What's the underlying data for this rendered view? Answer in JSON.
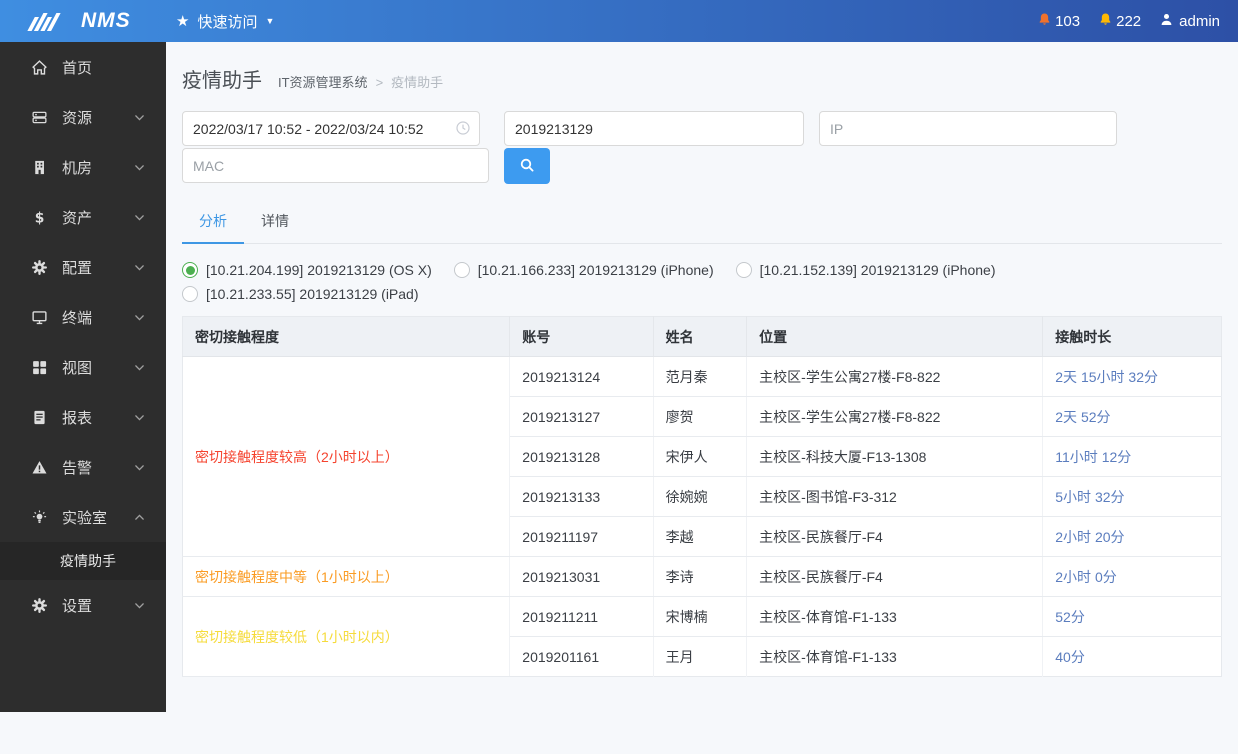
{
  "topbar": {
    "logo_text": "NMS",
    "quick_access_label": "快速访问",
    "alert_count_orange": "103",
    "alert_count_yellow": "222",
    "username": "admin"
  },
  "sidebar": {
    "items": [
      {
        "key": "home",
        "label": "首页",
        "icon": "home-icon",
        "chevron": null
      },
      {
        "key": "resources",
        "label": "资源",
        "icon": "resource-icon",
        "chevron": "down"
      },
      {
        "key": "server-room",
        "label": "机房",
        "icon": "building-icon",
        "chevron": "down"
      },
      {
        "key": "assets",
        "label": "资产",
        "icon": "dollar-icon",
        "chevron": "down"
      },
      {
        "key": "config",
        "label": "配置",
        "icon": "gear-icon",
        "chevron": "down"
      },
      {
        "key": "terminal",
        "label": "终端",
        "icon": "monitor-icon",
        "chevron": "down"
      },
      {
        "key": "views",
        "label": "视图",
        "icon": "grid-icon",
        "chevron": "down"
      },
      {
        "key": "reports",
        "label": "报表",
        "icon": "report-icon",
        "chevron": "down"
      },
      {
        "key": "alerts",
        "label": "告警",
        "icon": "alert-triangle-icon",
        "chevron": "down"
      },
      {
        "key": "lab",
        "label": "实验室",
        "icon": "lab-bulb-icon",
        "chevron": "up",
        "children": [
          {
            "key": "epidemic-assistant",
            "label": "疫情助手",
            "active": true
          }
        ]
      },
      {
        "key": "settings",
        "label": "设置",
        "icon": "gear-icon",
        "chevron": "down"
      }
    ]
  },
  "page": {
    "title": "疫情助手",
    "breadcrumb_root": "IT资源管理系统",
    "breadcrumb_sep": ">",
    "breadcrumb_current": "疫情助手"
  },
  "filters": {
    "date_range_value": "2022/03/17 10:52 - 2022/03/24 10:52",
    "account_value": "2019213129",
    "ip_placeholder": "IP",
    "mac_placeholder": "MAC"
  },
  "tabs": [
    {
      "label": "分析",
      "active": true
    },
    {
      "label": "详情",
      "active": false
    }
  ],
  "devices": [
    {
      "label": "[10.21.204.199] 2019213129 (OS X)",
      "selected": true
    },
    {
      "label": "[10.21.166.233] 2019213129 (iPhone)",
      "selected": false
    },
    {
      "label": "[10.21.152.139] 2019213129 (iPhone)",
      "selected": false
    },
    {
      "label": "[10.21.233.55] 2019213129 (iPad)",
      "selected": false
    }
  ],
  "table": {
    "headers": [
      "密切接触程度",
      "账号",
      "姓名",
      "位置",
      "接触时长"
    ],
    "groups": [
      {
        "level": "密切接触程度较高（2小时以上）",
        "color": "#F5432E",
        "rows": [
          [
            "2019213124",
            "范月秦",
            "主校区-学生公寓27楼-F8-822",
            "2天 15小时 32分"
          ],
          [
            "2019213127",
            "廖贺",
            "主校区-学生公寓27楼-F8-822",
            "2天 52分"
          ],
          [
            "2019213128",
            "宋伊人",
            "主校区-科技大厦-F13-1308",
            "11小时 12分"
          ],
          [
            "2019213133",
            "徐婉婉",
            "主校区-图书馆-F3-312",
            "5小时 32分"
          ],
          [
            "2019211197",
            "李越",
            "主校区-民族餐厅-F4",
            "2小时 20分"
          ]
        ]
      },
      {
        "level": "密切接触程度中等（1小时以上）",
        "color": "#FA9C23",
        "rows": [
          [
            "2019213031",
            "李诗",
            "主校区-民族餐厅-F4",
            "2小时 0分"
          ]
        ]
      },
      {
        "level": "密切接触程度较低（1小时以内）",
        "color": "#F6DB3C",
        "rows": [
          [
            "2019211211",
            "宋博楠",
            "主校区-体育馆-F1-133",
            "52分"
          ],
          [
            "2019201161",
            "王月",
            "主校区-体育馆-F1-133",
            "40分"
          ]
        ]
      }
    ]
  },
  "colors": {
    "topbar_gradient_start": "#3F8EE1",
    "topbar_gradient_end": "#2D50A6",
    "sidebar_bg": "#2D2D2D",
    "sidebar_active_bg": "#262626",
    "accent_blue": "#3E97E4",
    "search_button": "#3D9BF0",
    "radio_selected_green": "#4CAF50",
    "duration_link": "#5B7DBE",
    "bell_orange": "#F0722C",
    "bell_yellow": "#FFB903"
  }
}
